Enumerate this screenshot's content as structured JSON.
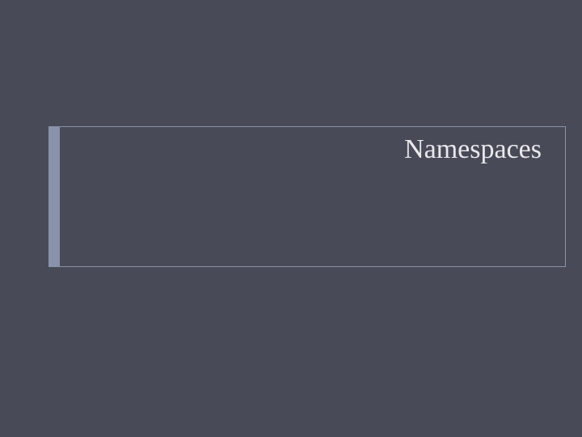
{
  "slide": {
    "title": "Namespaces"
  }
}
